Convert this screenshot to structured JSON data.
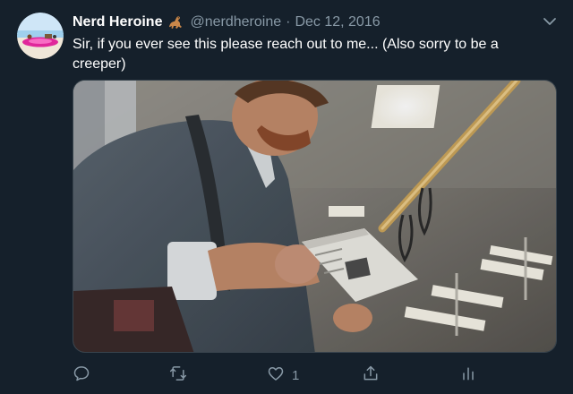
{
  "tweet": {
    "display_name": "Nerd Heroine",
    "handle": "@nerdheroine",
    "separator": "·",
    "date": "Dec 12, 2016",
    "text": "Sir, if you ever see this please reach out to me... (Also sorry to be a creeper)",
    "photo_alt": "",
    "actions": {
      "reply_count": "",
      "retweet_count": "",
      "like_count": "1",
      "share_count": ""
    }
  },
  "icons": {
    "emoji": "dinosaur-icon",
    "menu": "chevron-down-icon",
    "reply": "reply-icon",
    "retweet": "retweet-icon",
    "like": "heart-icon",
    "share": "share-icon",
    "analytics": "analytics-icon"
  },
  "colors": {
    "background": "#15202b",
    "text_primary": "#ffffff",
    "text_secondary": "#8899a6",
    "border": "#38444d"
  }
}
